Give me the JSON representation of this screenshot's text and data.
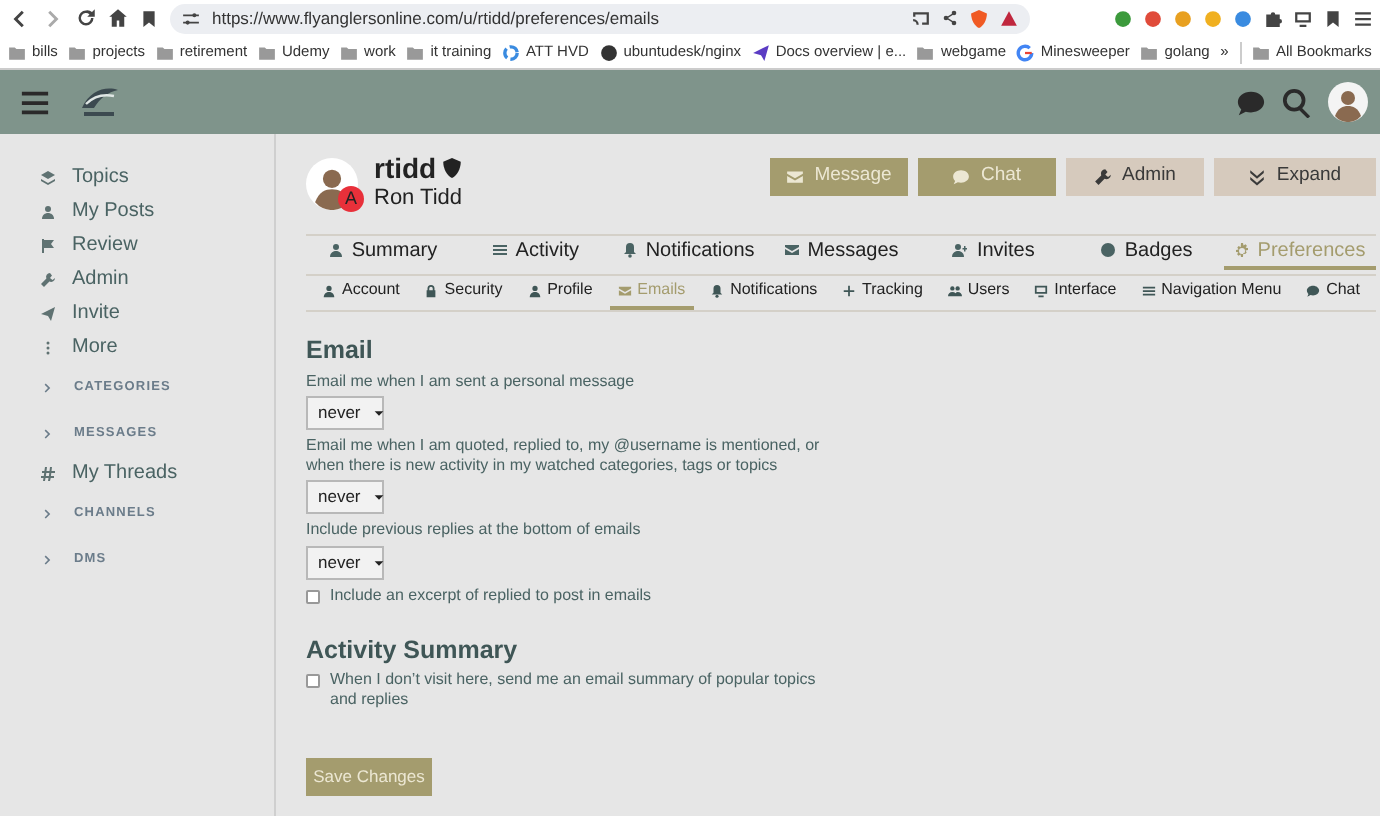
{
  "browser": {
    "url": "https://www.flyanglersonline.com/u/rtidd/preferences/emails",
    "bookmarks": [
      "bills",
      "projects",
      "retirement",
      "Udemy",
      "work",
      "it training",
      "ATT HVD",
      "ubuntudesk/nginx",
      "Docs overview | e...",
      "webgame",
      "Minesweeper",
      "golang"
    ],
    "overflow": "»",
    "all_bookmarks": "All Bookmarks"
  },
  "sidebar": {
    "items": [
      {
        "kind": "link",
        "label": "Topics"
      },
      {
        "kind": "link",
        "label": "My Posts"
      },
      {
        "kind": "link",
        "label": "Review"
      },
      {
        "kind": "link",
        "label": "Admin"
      },
      {
        "kind": "link",
        "label": "Invite"
      },
      {
        "kind": "link",
        "label": "More"
      },
      {
        "kind": "section",
        "label": "CATEGORIES"
      },
      {
        "kind": "section",
        "label": "MESSAGES"
      },
      {
        "kind": "link",
        "label": "My Threads"
      },
      {
        "kind": "section",
        "label": "CHANNELS"
      },
      {
        "kind": "section",
        "label": "DMS"
      }
    ]
  },
  "profile": {
    "username": "rtidd",
    "full_name": "Ron Tidd",
    "avatar_badge": "A",
    "actions": [
      {
        "kind": "primary",
        "label": "Message"
      },
      {
        "kind": "primary",
        "label": "Chat"
      },
      {
        "kind": "secondary",
        "label": "Admin"
      },
      {
        "kind": "secondary",
        "label": "Expand"
      }
    ],
    "tabs": [
      {
        "label": "Summary",
        "selected": false
      },
      {
        "label": "Activity",
        "selected": false
      },
      {
        "label": "Notifications",
        "selected": false
      },
      {
        "label": "Messages",
        "selected": false
      },
      {
        "label": "Invites",
        "selected": false
      },
      {
        "label": "Badges",
        "selected": false
      },
      {
        "label": "Preferences",
        "selected": true
      }
    ],
    "subtabs": [
      {
        "label": "Account",
        "selected": false
      },
      {
        "label": "Security",
        "selected": false
      },
      {
        "label": "Profile",
        "selected": false
      },
      {
        "label": "Emails",
        "selected": true
      },
      {
        "label": "Notifications",
        "selected": false
      },
      {
        "label": "Tracking",
        "selected": false
      },
      {
        "label": "Users",
        "selected": false
      },
      {
        "label": "Interface",
        "selected": false
      },
      {
        "label": "Navigation Menu",
        "selected": false
      },
      {
        "label": "Chat",
        "selected": false
      }
    ]
  },
  "sections": [
    {
      "title": "Email",
      "fields": [
        {
          "kind": "select",
          "label": "Email me when I am sent a personal message",
          "value": "never"
        },
        {
          "kind": "select",
          "label": "Email me when I am quoted, replied to, my @username is mentioned, or when there is new activity in my watched categories, tags or topics",
          "value": "never"
        },
        {
          "kind": "select",
          "label": "Include previous replies at the bottom of emails",
          "value": "never"
        },
        {
          "kind": "checkbox",
          "label": "Include an excerpt of replied to post in emails",
          "checked": false
        }
      ]
    },
    {
      "title": "Activity Summary",
      "fields": [
        {
          "kind": "checkbox",
          "label": "When I don’t visit here, send me an email summary of popular topics and replies",
          "checked": false
        }
      ]
    }
  ],
  "save_button": "Save Changes"
}
